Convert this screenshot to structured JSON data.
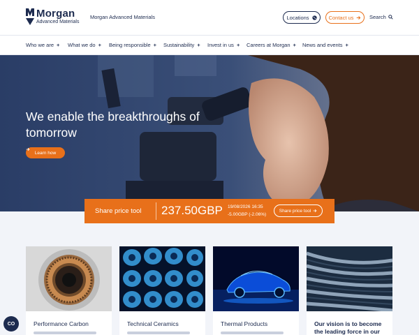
{
  "brand": {
    "name": "Morgan",
    "subname": "Advanced Materials",
    "tagline": "Morgan Advanced Materials"
  },
  "header": {
    "locations_label": "Locations",
    "contact_label": "Contact us",
    "search_label": "Search"
  },
  "nav": {
    "items": [
      {
        "label": "Who we are"
      },
      {
        "label": "What we do"
      },
      {
        "label": "Being responsible"
      },
      {
        "label": "Sustainability"
      },
      {
        "label": "Invest in us"
      },
      {
        "label": "Careers at Morgan"
      },
      {
        "label": "News and events"
      }
    ]
  },
  "hero": {
    "title": "We enable the breakthroughs of tomorrow",
    "button_label": "Learn how"
  },
  "share": {
    "label": "Share price tool",
    "price": "237.50GBP",
    "datetime": "19/08/2026 16:35",
    "change": "-5.00GBP (-2.06%)",
    "button_label": "Share price tool"
  },
  "cards": [
    {
      "title": "Performance Carbon"
    },
    {
      "title": "Technical Ceramics"
    },
    {
      "title": "Thermal Products"
    }
  ],
  "vision": {
    "text": "Our vision is to become the leading force in our"
  },
  "cookie": {
    "label": "CO"
  },
  "colors": {
    "accent": "#e8701a",
    "navy": "#1d2b4f",
    "background": "#f2f4f9"
  }
}
